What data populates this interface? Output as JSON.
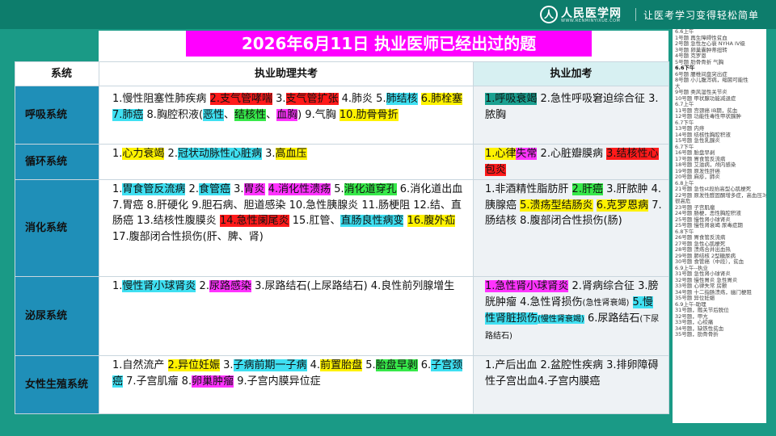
{
  "header": {
    "logo_mark": "人",
    "logo_name": "人民医学网",
    "logo_url": "WWW.RENMINYIXUE.COM",
    "slogan": "让医考学习变得轻松简单"
  },
  "title": "2026年6月11日 执业医师已经出过的题",
  "table": {
    "col_system": "系统",
    "col_shared": "执业助理共考",
    "col_extra": "执业加考",
    "rows": [
      {
        "system": "呼吸系统",
        "shared": [
          {
            "t": "1.慢性阻塞性肺疾病 ",
            "h": ""
          },
          {
            "t": "2.支气管哮喘",
            "h": "r"
          },
          {
            "t": " 3.",
            "h": ""
          },
          {
            "t": "支气管扩张",
            "h": "r"
          },
          {
            "t": " 4.肺炎 5.",
            "h": ""
          },
          {
            "t": "肺结核",
            "h": "c"
          },
          {
            "t": " ",
            "h": ""
          },
          {
            "t": "6.肺栓塞",
            "h": "y"
          },
          {
            "t": " ",
            "h": ""
          },
          {
            "t": "7.肺癌",
            "h": "c"
          },
          {
            "t": " 8.胸腔积液(",
            "h": ""
          },
          {
            "t": "恶性",
            "h": "c"
          },
          {
            "t": "、",
            "h": ""
          },
          {
            "t": "结核性",
            "h": "g"
          },
          {
            "t": "、",
            "h": ""
          },
          {
            "t": "血胸",
            "h": "m"
          },
          {
            "t": ") 9.气胸 ",
            "h": ""
          },
          {
            "t": "10.肋骨骨折",
            "h": "y"
          }
        ],
        "extra": [
          {
            "t": "1.呼吸衰竭",
            "h": "t"
          },
          {
            "t": " 2.急性呼吸窘迫综合征 3.脓胸",
            "h": ""
          }
        ]
      },
      {
        "system": "循环系统",
        "shared": [
          {
            "t": "1.",
            "h": ""
          },
          {
            "t": "心力衰竭",
            "h": "y"
          },
          {
            "t": " 2.",
            "h": ""
          },
          {
            "t": "冠状动脉性心脏病",
            "h": "c"
          },
          {
            "t": " 3.",
            "h": ""
          },
          {
            "t": "高血压",
            "h": "y"
          }
        ],
        "extra": [
          {
            "t": "1.心律",
            "h": "y"
          },
          {
            "t": "失常",
            "h": "m"
          },
          {
            "t": " 2.心脏瓣膜病 ",
            "h": ""
          },
          {
            "t": "3.结核性心包炎",
            "h": "r"
          }
        ]
      },
      {
        "system": "消化系统",
        "shared": [
          {
            "t": "1.",
            "h": ""
          },
          {
            "t": "胃食管反流病",
            "h": "c"
          },
          {
            "t": " 2.",
            "h": ""
          },
          {
            "t": "食管癌",
            "h": "c"
          },
          {
            "t": " 3.",
            "h": ""
          },
          {
            "t": "胃炎",
            "h": "m"
          },
          {
            "t": " ",
            "h": ""
          },
          {
            "t": "4.消化性溃疡",
            "h": "m"
          },
          {
            "t": " 5.",
            "h": ""
          },
          {
            "t": "消化道穿孔",
            "h": "g"
          },
          {
            "t": " 6.消化道出血 7.胃癌 8.肝硬化 9.胆石病、胆道感染 10.急性胰腺炎 11.肠梗阻 12.结、直肠癌 13.结核性腹膜炎 ",
            "h": ""
          },
          {
            "t": "14.急性阑尾炎",
            "h": "r"
          },
          {
            "t": " 15.肛管、",
            "h": ""
          },
          {
            "t": "直肠良性病变",
            "h": "c"
          },
          {
            "t": " ",
            "h": ""
          },
          {
            "t": "16.腹外疝",
            "h": "y"
          },
          {
            "t": " 17.腹部闭合性损伤(肝、脾、肾)",
            "h": ""
          }
        ],
        "extra": [
          {
            "t": "1.非酒精性脂肪肝 ",
            "h": ""
          },
          {
            "t": "2.肝癌",
            "h": "g"
          },
          {
            "t": " 3.肝脓肿 4.胰腺癌 ",
            "h": ""
          },
          {
            "t": "5.溃疡型结肠炎",
            "h": "y"
          },
          {
            "t": " ",
            "h": ""
          },
          {
            "t": "6.克罗恩病",
            "h": "y"
          },
          {
            "t": " 7.肠结核 8.腹部闭合性损伤(肠)",
            "h": ""
          }
        ]
      },
      {
        "system": "泌尿系统",
        "shared": [
          {
            "t": "1.",
            "h": ""
          },
          {
            "t": "慢性肾小球肾炎",
            "h": "c"
          },
          {
            "t": " 2.",
            "h": ""
          },
          {
            "t": "尿路感染",
            "h": "m"
          },
          {
            "t": " 3.尿路结石(上尿路结石) 4.良性前列腺增生",
            "h": ""
          }
        ],
        "extra": [
          {
            "t": "1.急性肾小球肾炎",
            "h": "m"
          },
          {
            "t": " 2.肾病综合征 3.膀胱肿瘤 4.急性肾损伤",
            "h": ""
          },
          {
            "t": "(急性肾衰竭)",
            "h": "",
            "small": true
          },
          {
            "t": " ",
            "h": ""
          },
          {
            "t": "5.慢性肾脏损伤",
            "h": "c"
          },
          {
            "t": "(慢性肾衰竭)",
            "h": "c",
            "small": true
          },
          {
            "t": " 6.尿路结石",
            "h": ""
          },
          {
            "t": "(下尿路结石)",
            "h": "",
            "small": true
          }
        ]
      },
      {
        "system": "女性生殖系统",
        "shared": [
          {
            "t": "1.自然流产 ",
            "h": ""
          },
          {
            "t": "2.异位妊娠",
            "h": "y"
          },
          {
            "t": " 3.",
            "h": ""
          },
          {
            "t": "子病前期一子病",
            "h": "c"
          },
          {
            "t": " 4.",
            "h": ""
          },
          {
            "t": "前置胎盘",
            "h": "y"
          },
          {
            "t": " 5.",
            "h": ""
          },
          {
            "t": "胎盘早剥",
            "h": "g"
          },
          {
            "t": " 6.",
            "h": ""
          },
          {
            "t": "子宫颈癌",
            "h": "c"
          },
          {
            "t": " 7.子宫肌瘤 8.",
            "h": ""
          },
          {
            "t": "卵巢肿瘤",
            "h": "m"
          },
          {
            "t": " 9.子宫内膜异位症",
            "h": ""
          }
        ],
        "extra": [
          {
            "t": "1.产后出血 2.盆腔性疾病 3.排卵障碍性子宫出血4.子宫内膜癌",
            "h": ""
          }
        ]
      }
    ]
  },
  "sidebar_lines": [
    {
      "t": "6.6上午",
      "b": false
    },
    {
      "t": "1号题 再生障碍性贫血",
      "b": false
    },
    {
      "t": "2号题 急性左心衰 NYHA IV级",
      "b": false
    },
    {
      "t": "3号题 卵巢囊肿蒂扭转",
      "b": false
    },
    {
      "t": "4号题 克罗恩",
      "b": false
    },
    {
      "t": "5号题 肋骨骨折 气胸",
      "b": false
    },
    {
      "t": "6.6下午",
      "b": true
    },
    {
      "t": "6号题 腰椎间盘突出症",
      "b": false
    },
    {
      "t": "8号题 小儿腹泻病，缩菌可能性",
      "b": false
    },
    {
      "t": "大",
      "b": false
    },
    {
      "t": "9号题 类风湿性关节炎",
      "b": false
    },
    {
      "t": "10号题 甲状腺功能减退症",
      "b": false
    },
    {
      "t": "6.7上午",
      "b": false
    },
    {
      "t": "11号题 宫颈癌 IB期，贫血",
      "b": false
    },
    {
      "t": "12号题 功能性毒性甲状腺肿",
      "b": false
    },
    {
      "t": "6.7下午",
      "b": false
    },
    {
      "t": "13号题 内痔",
      "b": false
    },
    {
      "t": "14号题 结核性胸腔积液",
      "b": false
    },
    {
      "t": "15号题 急性乳腺炎",
      "b": false
    },
    {
      "t": "6.7下午",
      "b": false
    },
    {
      "t": "16号题 胎盘早剥",
      "b": false
    },
    {
      "t": "17号题 胃食管反流病",
      "b": false
    },
    {
      "t": "18号题 艾滋病，颅内感染",
      "b": false
    },
    {
      "t": "19号题 原发性肝癌",
      "b": false
    },
    {
      "t": "20号题 麻疹，肺炎",
      "b": false
    },
    {
      "t": "6.8上午",
      "b": false
    },
    {
      "t": "21号题 急性st段抬高型心肌梗死",
      "b": false
    },
    {
      "t": "22号题 原发性醛固酮增多症，高血压3级",
      "b": false
    },
    {
      "t": "很高危",
      "b": false
    },
    {
      "t": "23号题 子宫肌瘤",
      "b": false
    },
    {
      "t": "24号题 肠梗，恶性胸腔积液",
      "b": false
    },
    {
      "t": "25号题 慢性肾小球肾炎",
      "b": false
    },
    {
      "t": "25号题 慢性肾衰竭 尿毒症期",
      "b": false
    },
    {
      "t": "6.8下午",
      "b": false
    },
    {
      "t": "26号题 胃食管反流病",
      "b": false
    },
    {
      "t": "27号题 急性心肌梗死",
      "b": false
    },
    {
      "t": "28号题 溃疡合并出血热",
      "b": false
    },
    {
      "t": "29号题 肺结核 2型糖尿病",
      "b": false
    },
    {
      "t": "30号题 食管癌（中段），贫血",
      "b": false
    },
    {
      "t": "6.9上午--执业",
      "b": false
    },
    {
      "t": "31号题 急性肾小球肾炎",
      "b": false
    },
    {
      "t": "32号题 慢性胃炎 急性胃炎",
      "b": false
    },
    {
      "t": "33号题 心律失常 房颤",
      "b": false
    },
    {
      "t": "34号题 十二指肠溃疡，幽门梗阻",
      "b": false
    },
    {
      "t": "35号题 异位妊娠",
      "b": false
    },
    {
      "t": "6.9上午-助理",
      "b": false
    },
    {
      "t": "31号题，髋关节后脱位",
      "b": false
    },
    {
      "t": "32号题，甲亢",
      "b": false
    },
    {
      "t": "33号题，心绞痛",
      "b": false
    },
    {
      "t": "34号题，缺铁性贫血",
      "b": false
    },
    {
      "t": "35号题，肋骨骨折",
      "b": false
    }
  ],
  "colors": {
    "yellow": "#fff200",
    "red": "#ff1a1a",
    "cyan": "#3fe0f2",
    "green": "#37e94a",
    "magenta": "#ff33ff",
    "teal": "#1aa090",
    "title_bg": "#ff00ff",
    "system_bg": "#1f8fb8",
    "page_bg": "#1a9a86"
  }
}
